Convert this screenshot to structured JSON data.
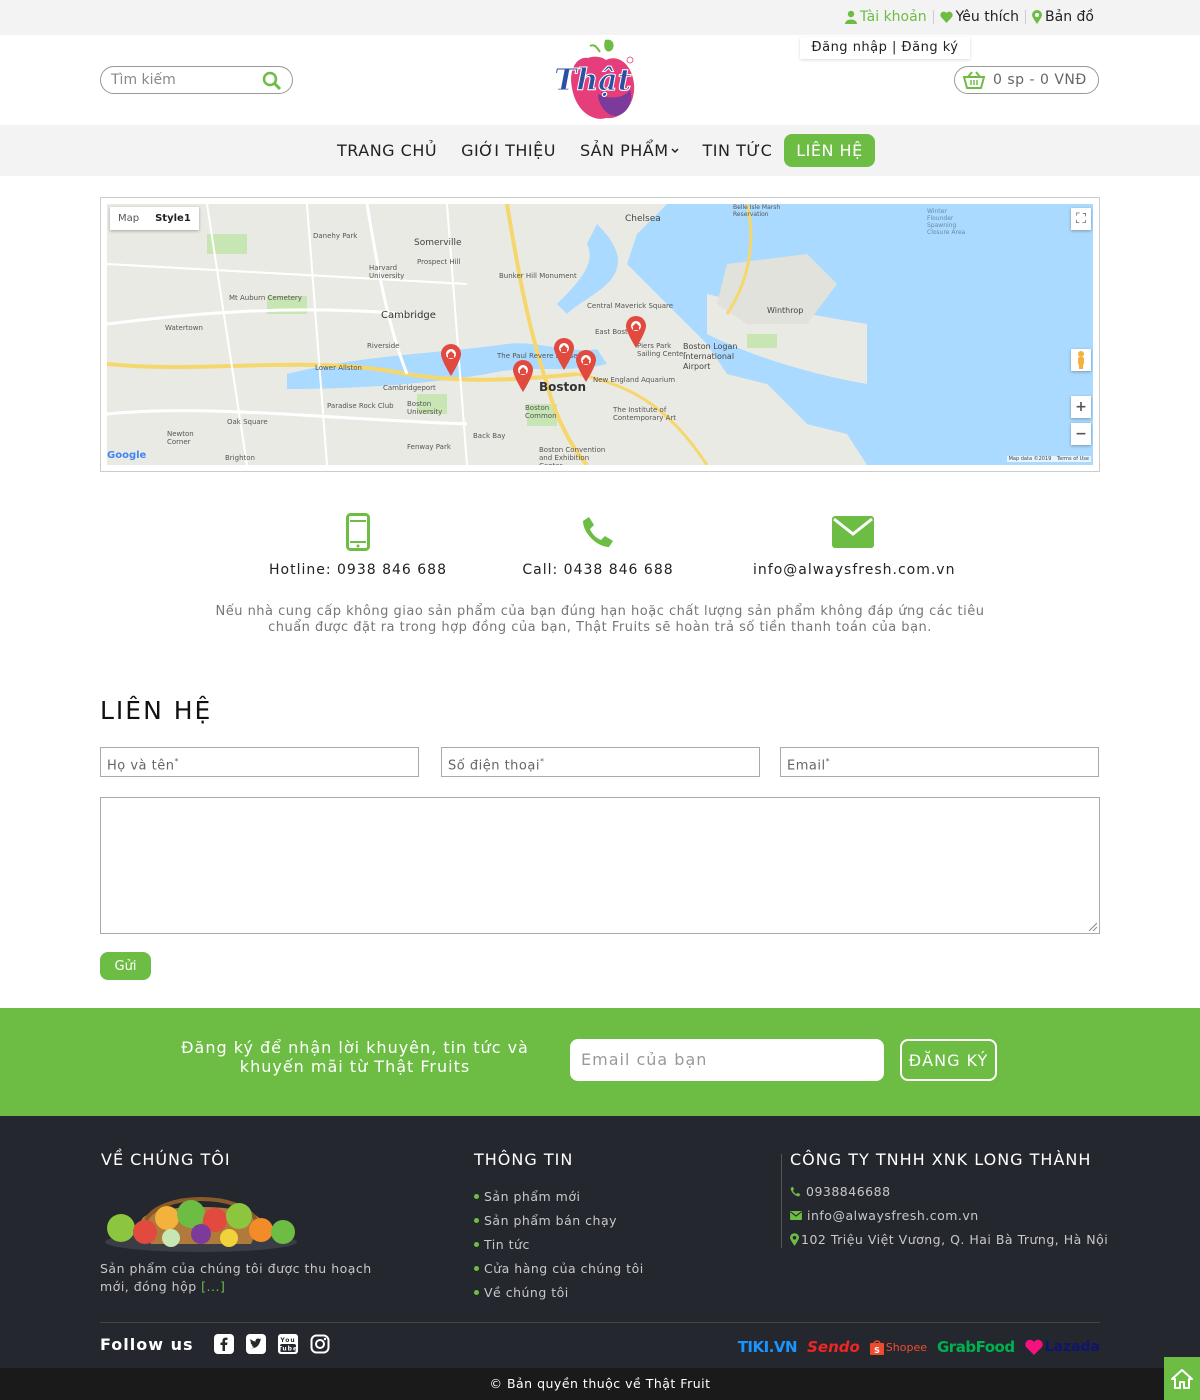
{
  "topbar": {
    "account": "Tài khoản",
    "favorite": "Yêu thích",
    "map": "Bản đồ",
    "login_register": "Đăng nhập | Đăng ký"
  },
  "header": {
    "search_placeholder": "Tìm kiếm",
    "logo_text": "Thật",
    "cart_text": "0 sp - 0 VNĐ"
  },
  "nav": {
    "items": [
      "TRANG CHỦ",
      "GIỚI THIỆU",
      "SẢN PHẨM",
      "TIN TỨC",
      "LIÊN HỆ"
    ],
    "active": "LIÊN HỆ"
  },
  "map": {
    "type_map": "Map",
    "type_style": "Style1",
    "labels": [
      "Somerville",
      "Cambridge",
      "Boston",
      "Chelsea",
      "Winthrop",
      "Boston Logan International Airport",
      "Bunker Hill Monument",
      "Watertown",
      "Brighton",
      "Fenway Park",
      "Back Bay",
      "New England Aquarium",
      "Paradise Rock Club",
      "Boston University",
      "Boston Common",
      "Lower Allston",
      "Central Maverick Square",
      "East Boston",
      "Piers Park Sailing Center",
      "The Institute of Contemporary Art",
      "Boston Convention and Exhibition Center",
      "Harvard University",
      "Mt Auburn Cemetery",
      "Danehy Park",
      "Prospect Hill",
      "Winter Flounder Spawning Closure Area",
      "Belle Isle Marsh Reservation",
      "Oak Square",
      "Newton Corner",
      "Cambridgeport",
      "Riverside",
      "The Paul Revere House"
    ],
    "attribution": "Map data ©2019",
    "terms": "Terms of Use",
    "google": "Google",
    "zoom_in": "+",
    "zoom_out": "−"
  },
  "contacts": {
    "hotline": "Hotline: 0938 846 688",
    "call": "Call: 0438 846 688",
    "email": "info@alwaysfresh.com.vn"
  },
  "policy": "Nếu nhà cung cấp không giao sản phẩm của bạn đúng hạn hoặc chất lượng sản phẩm không đáp ứng các tiêu chuẩn được đặt ra trong hợp đồng của bạn, Thật Fruits sẽ hoàn trả số tiền thanh toán của bạn.",
  "form": {
    "title": "LIÊN HỆ",
    "name_placeholder": "Họ và tên",
    "phone_placeholder": "Số điện thoại",
    "email_placeholder": "Email",
    "required_mark": "*",
    "send": "Gửi"
  },
  "newsletter": {
    "text": "Đăng ký để nhận lời khuyên, tin tức và khuyến mãi từ Thật Fruits",
    "email_placeholder": "Email của bạn",
    "button": "ĐĂNG KÝ"
  },
  "footer": {
    "about_title": "VỀ CHÚNG TÔI",
    "about_text": "Sản phẩm của chúng tôi được thu hoạch mới, đóng hộp",
    "about_more": "[...]",
    "info_title": "THÔNG TIN",
    "info_items": [
      "Sản phẩm mới",
      "Sản phẩm bán chạy",
      "Tin tức",
      "Cửa hàng của chúng tôi",
      "Về chúng tôi"
    ],
    "company_title": "CÔNG TY TNHH XNK LONG THÀNH",
    "company_phone": "0938846688",
    "company_email": "info@alwaysfresh.com.vn",
    "company_address": "102 Triệu Việt Vương, Q. Hai Bà Trưng, Hà Nội",
    "follow": "Follow us",
    "partners": [
      "TIKI.VN",
      "Sendo",
      "Shopee",
      "GrabFood",
      "Lazada"
    ],
    "copyright": "© Bản quyền thuộc về Thật Fruit"
  },
  "colors": {
    "brand_green": "#6dbd45",
    "footer_bg": "#25272f",
    "map_marker": "#e2493f",
    "water": "#aadaff"
  }
}
